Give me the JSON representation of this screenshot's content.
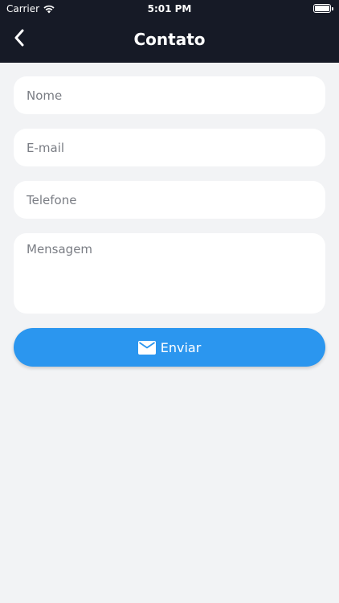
{
  "status_bar": {
    "carrier": "Carrier",
    "time": "5:01 PM",
    "icons": [
      "wifi-icon",
      "battery-icon"
    ]
  },
  "header": {
    "title": "Contato",
    "back_icon": "chevron-left-icon"
  },
  "form": {
    "name_placeholder": "Nome",
    "email_placeholder": "E-mail",
    "phone_placeholder": "Telefone",
    "message_placeholder": "Mensagem",
    "send_label": "Enviar",
    "send_icon": "mail-icon"
  },
  "colors": {
    "header_bg": "#161a26",
    "page_bg": "#f2f3f5",
    "field_bg": "#ffffff",
    "accent": "#2b96ef"
  }
}
